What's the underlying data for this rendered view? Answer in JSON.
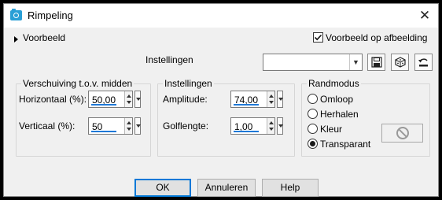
{
  "window": {
    "title": "Rimpeling",
    "close_symbol": "✕"
  },
  "preview": {
    "toggle_label": "Voorbeeld",
    "on_image_label": "Voorbeeld op afbeelding",
    "on_image_checked": true
  },
  "presets": {
    "label": "Instellingen",
    "value": ""
  },
  "offset_group": {
    "legend": "Verschuiving t.o.v. midden",
    "horizontal_label": "Horizontaal (%):",
    "horizontal_value": "50,00",
    "vertical_label": "Verticaal (%):",
    "vertical_value": "50"
  },
  "settings_group": {
    "legend": "Instellingen",
    "amplitude_label": "Amplitude:",
    "amplitude_value": "74,00",
    "wavelength_label": "Golflengte:",
    "wavelength_value": "1,00"
  },
  "edge_group": {
    "legend": "Randmodus",
    "options": [
      "Omloop",
      "Herhalen",
      "Kleur",
      "Transparant"
    ],
    "selected": "Transparant"
  },
  "buttons": {
    "ok": "OK",
    "cancel": "Annuleren",
    "help": "Help"
  },
  "colors": {
    "accent": "#1e78d7",
    "title_icon": "#2a9fd6",
    "background": "#f0f0f0"
  }
}
